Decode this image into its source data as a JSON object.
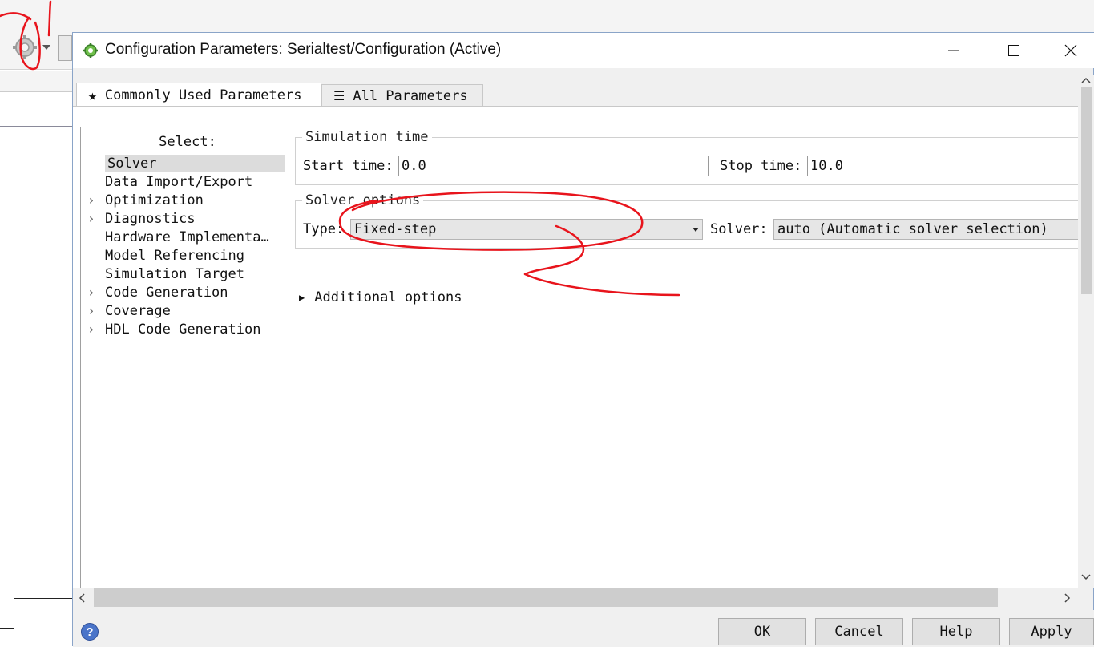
{
  "dialog": {
    "title": "Configuration Parameters: Serialtest/Configuration (Active)",
    "tabs": [
      {
        "label": "Commonly Used Parameters",
        "icon": "star-icon",
        "selected": true
      },
      {
        "label": "All Parameters",
        "icon": "list-icon",
        "selected": false
      }
    ],
    "tree": {
      "header": "Select:",
      "items": [
        {
          "label": "Solver",
          "expandable": false,
          "selected": true
        },
        {
          "label": "Data Import/Export",
          "expandable": false
        },
        {
          "label": "Optimization",
          "expandable": true
        },
        {
          "label": "Diagnostics",
          "expandable": true
        },
        {
          "label": "Hardware Implementa…",
          "expandable": false
        },
        {
          "label": "Model Referencing",
          "expandable": false
        },
        {
          "label": "Simulation Target",
          "expandable": false
        },
        {
          "label": "Code Generation",
          "expandable": true
        },
        {
          "label": "Coverage",
          "expandable": true
        },
        {
          "label": "HDL Code Generation",
          "expandable": true
        }
      ]
    },
    "simulation_time": {
      "legend": "Simulation time",
      "start_label": "Start time:",
      "start_value": "0.0",
      "stop_label": "Stop time:",
      "stop_value": "10.0"
    },
    "solver_options": {
      "legend": "Solver options",
      "type_label": "Type:",
      "type_value": "Fixed-step",
      "solver_label": "Solver:",
      "solver_value": "auto (Automatic solver selection)"
    },
    "additional_options": "Additional options",
    "buttons": {
      "ok": "OK",
      "cancel": "Cancel",
      "help": "Help",
      "apply": "Apply"
    },
    "help_icon_text": "?"
  },
  "colors": {
    "annotation": "#e8141c",
    "selection": "#dcdcdc",
    "dialog_bg": "#f0f0f0"
  }
}
